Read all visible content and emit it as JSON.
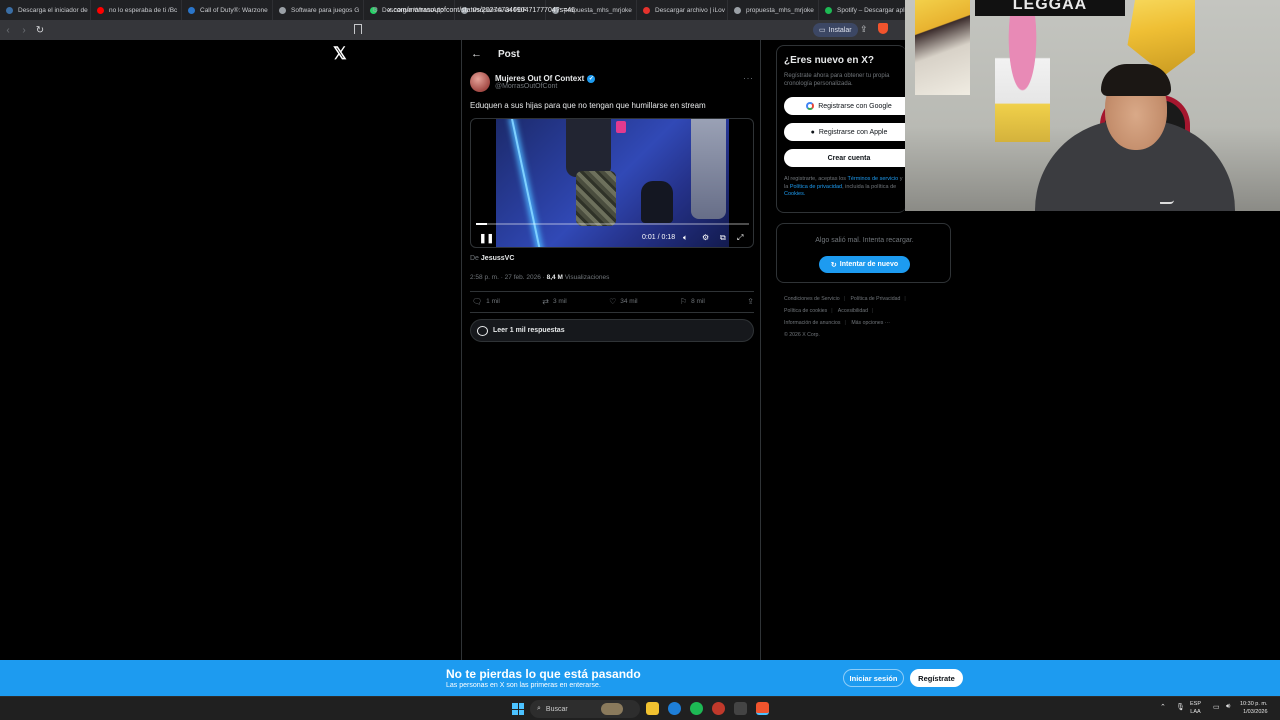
{
  "browser": {
    "tabs": [
      {
        "label": "Descarga el iniciador de",
        "color": "#3a6ea5"
      },
      {
        "label": "no lo esperaba de ti /Bc",
        "color": "#ff0000"
      },
      {
        "label": "Call of Duty®: Warzone",
        "color": "#2a75c9"
      },
      {
        "label": "Software para juegos G",
        "color": "#9aa0a6"
      },
      {
        "label": "Descargar WhatsApp",
        "color": "#25d366"
      },
      {
        "label": "Propuesta en PDF",
        "color": "#9aa0a6"
      },
      {
        "label": "propuesta_mhs_mrjoke",
        "color": "#9aa0a6"
      },
      {
        "label": "Descargar archivo | iLov",
        "color": "#e5322d"
      },
      {
        "label": "propuesta_mhs_mrjoke",
        "color": "#9aa0a6"
      },
      {
        "label": "Spotify – Descargar aplic",
        "color": "#1db954"
      }
    ],
    "url": "x.com/morrasoutofcont/status/2027473469047177704?s=46",
    "install_label": "Instalar"
  },
  "post": {
    "header_title": "Post",
    "author_name": "Mujeres Out Of Context",
    "author_handle": "@MorrasOutOfCont",
    "text": "Eduquen a sus hijas para que no tengan que humillarse en stream",
    "video": {
      "time": "0:01 / 0:18",
      "progress": 0.04
    },
    "from_prefix": "De",
    "from_user": "JesussVC",
    "timestamp": "2:58 p. m. · 27 feb. 2026 ·",
    "views_count": "8,4 M",
    "views_label": "Visualizaciones",
    "replies": "1 mil",
    "reposts": "3 mil",
    "likes": "34 mil",
    "bookmarks": "8 mil",
    "read_replies_label": "Leer 1 mil respuestas"
  },
  "sidebar": {
    "signup_title": "¿Eres nuevo en X?",
    "signup_sub": "Regístrate ahora para obtener tu propia cronología personalizada.",
    "google_label": "Registrarse con Google",
    "apple_label": "Registrarse con Apple",
    "create_label": "Crear cuenta",
    "legal_prefix": "Al registrarte, aceptas los",
    "legal_terms": "Términos de servicio",
    "legal_and": "y la",
    "legal_privacy": "Política de privacidad",
    "legal_mid": ", incluida la política de",
    "legal_cookies": "Cookies.",
    "error_text": "Algo salió mal. Intenta recargar.",
    "retry_label": "Intentar de nuevo",
    "footer": [
      "Condiciones de Servicio",
      "Política de Privacidad",
      "Política de cookies",
      "Accesibilidad",
      "Información de anuncios",
      "Más opciones ···",
      "© 2026 X Corp."
    ]
  },
  "webcam": {
    "poster_text": "LEGGAA"
  },
  "banner": {
    "title": "No te pierdas lo que está pasando",
    "subtitle": "Las personas en X son las primeras en enterarse.",
    "login_label": "Iniciar sesión",
    "register_label": "Regístrate"
  },
  "taskbar": {
    "search_placeholder": "Buscar",
    "lang_top": "ESP",
    "lang_bottom": "LAA",
    "time": "10:30 p. m.",
    "date": "1/03/2026"
  },
  "colors": {
    "accent": "#1d9bf0",
    "background": "#000000",
    "border": "#2f3336"
  }
}
